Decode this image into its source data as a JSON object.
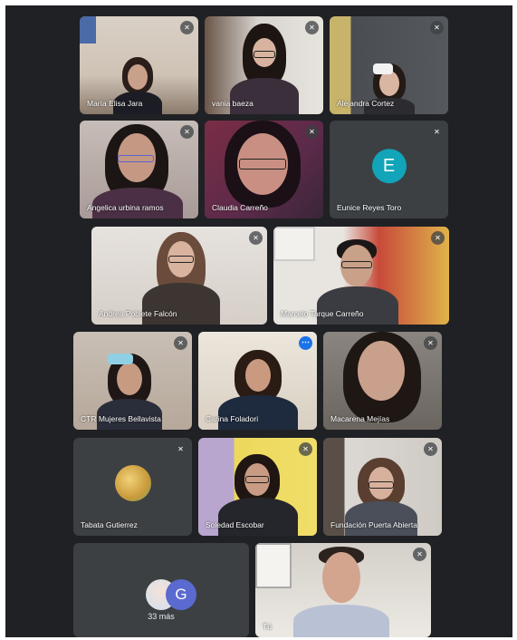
{
  "meeting": {
    "tiles": [
      {
        "name": "María Elisa Jara",
        "mic": "muted"
      },
      {
        "name": "vania baeza",
        "mic": "muted"
      },
      {
        "name": "Alejandra Cortez",
        "mic": "muted"
      },
      {
        "name": "Angelica urbina ramos",
        "mic": "muted"
      },
      {
        "name": "Claudia Carreño",
        "mic": "muted"
      },
      {
        "name": "Eunice Reyes Toro",
        "mic": "muted",
        "initial": "E",
        "avatar_color": "#12a4b8"
      },
      {
        "name": "Andrea Poblete Falcón",
        "mic": "muted"
      },
      {
        "name": "Marcelo Tarque Carreño",
        "mic": "muted"
      },
      {
        "name": "CTR Mujeres Bellavista",
        "mic": "muted"
      },
      {
        "name": "Carina Foladori",
        "mic": "active",
        "options_icon": "⋯"
      },
      {
        "name": "Macarena Mejías",
        "mic": "muted"
      },
      {
        "name": "Tabata Gutierrez",
        "mic": "muted"
      },
      {
        "name": "Soledad Escobar",
        "mic": "muted"
      },
      {
        "name": "Fundación Puerta Abierta",
        "mic": "muted"
      },
      {
        "name": "Tú",
        "mic": "muted"
      }
    ],
    "overflow": {
      "count_label": "33 más",
      "initial": "G",
      "avatar_color": "#5b6ad0"
    },
    "mic_muted_glyph": "✕"
  }
}
